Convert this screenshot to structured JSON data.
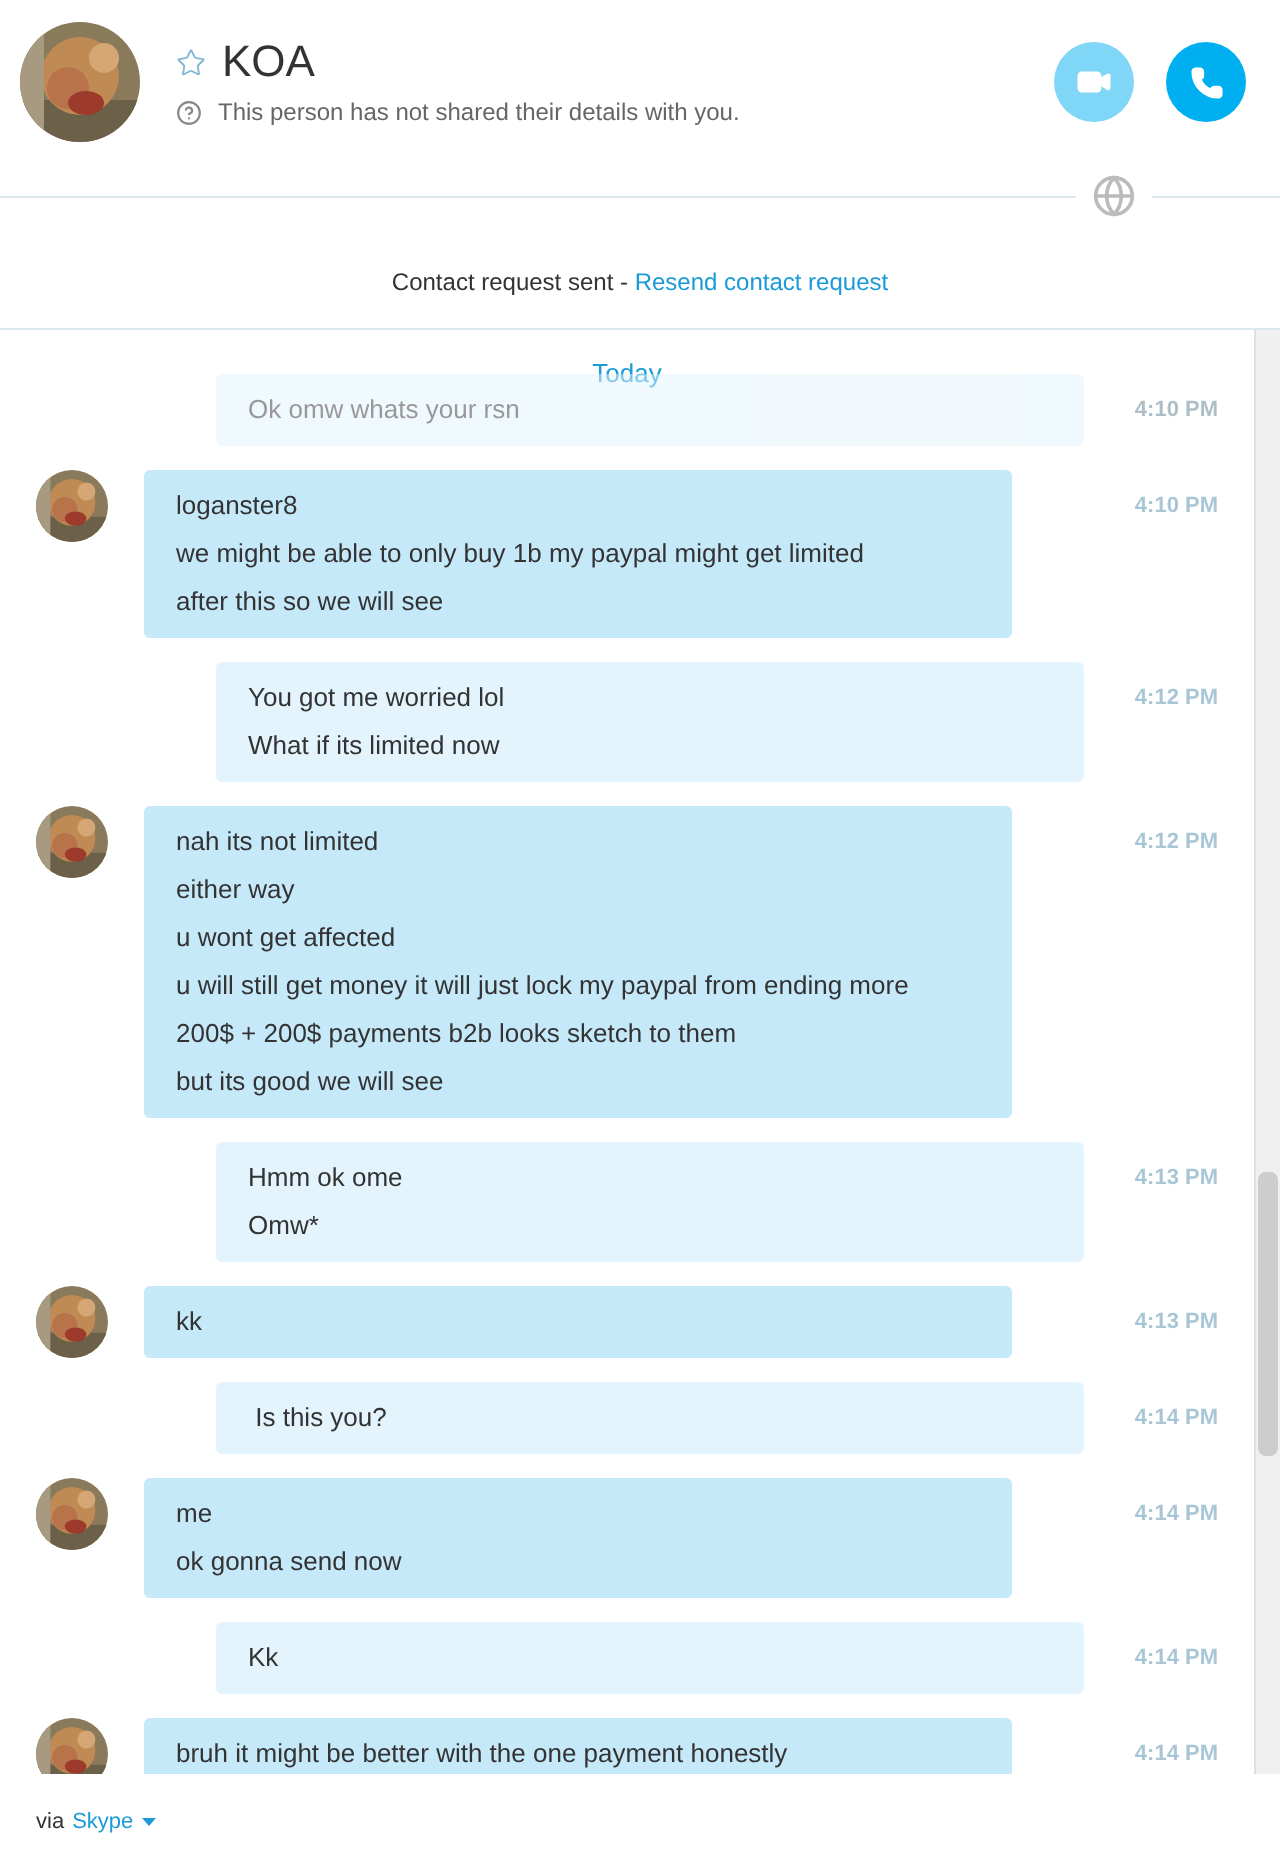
{
  "contact": {
    "name": "KOA",
    "favorite": false,
    "status": "This person has not shared their details with you."
  },
  "request": {
    "text": "Contact request sent - ",
    "link": "Resend contact request"
  },
  "day": "Today",
  "messages": [
    {
      "kind": "outgoing",
      "faded": true,
      "lines": [
        "Ok omw whats your rsn"
      ],
      "time": "4:10 PM"
    },
    {
      "kind": "incoming",
      "faded": false,
      "sender": "loganster8",
      "lines": [
        "we might be able to only buy 1b my paypal might get limited",
        "after this so we will see"
      ],
      "time": "4:10 PM"
    },
    {
      "kind": "outgoing",
      "faded": false,
      "lines": [
        "You got me worried lol",
        "What if its limited now"
      ],
      "time": "4:12 PM"
    },
    {
      "kind": "incoming",
      "faded": false,
      "lines": [
        "nah its not limited",
        "either way",
        "u wont get affected",
        "u will still get money it will just lock my paypal from ending more",
        "200$ + 200$ payments b2b looks sketch to them",
        "but its good we will see"
      ],
      "time": "4:12 PM"
    },
    {
      "kind": "outgoing",
      "faded": false,
      "lines": [
        "Hmm ok ome",
        "Omw*"
      ],
      "time": "4:13 PM"
    },
    {
      "kind": "incoming",
      "faded": false,
      "lines": [
        "kk"
      ],
      "time": "4:13 PM"
    },
    {
      "kind": "outgoing",
      "faded": false,
      "lines": [
        " Is this you?"
      ],
      "time": "4:14 PM"
    },
    {
      "kind": "incoming",
      "faded": false,
      "lines": [
        "me",
        "ok gonna send now"
      ],
      "time": "4:14 PM"
    },
    {
      "kind": "outgoing",
      "faded": false,
      "lines": [
        "Kk"
      ],
      "time": "4:14 PM"
    },
    {
      "kind": "incoming",
      "faded": false,
      "lines": [
        "bruh it might be better with the one payment honestly"
      ],
      "time": "4:14 PM"
    }
  ],
  "footer": {
    "prefix": "via",
    "service": "Skype"
  }
}
